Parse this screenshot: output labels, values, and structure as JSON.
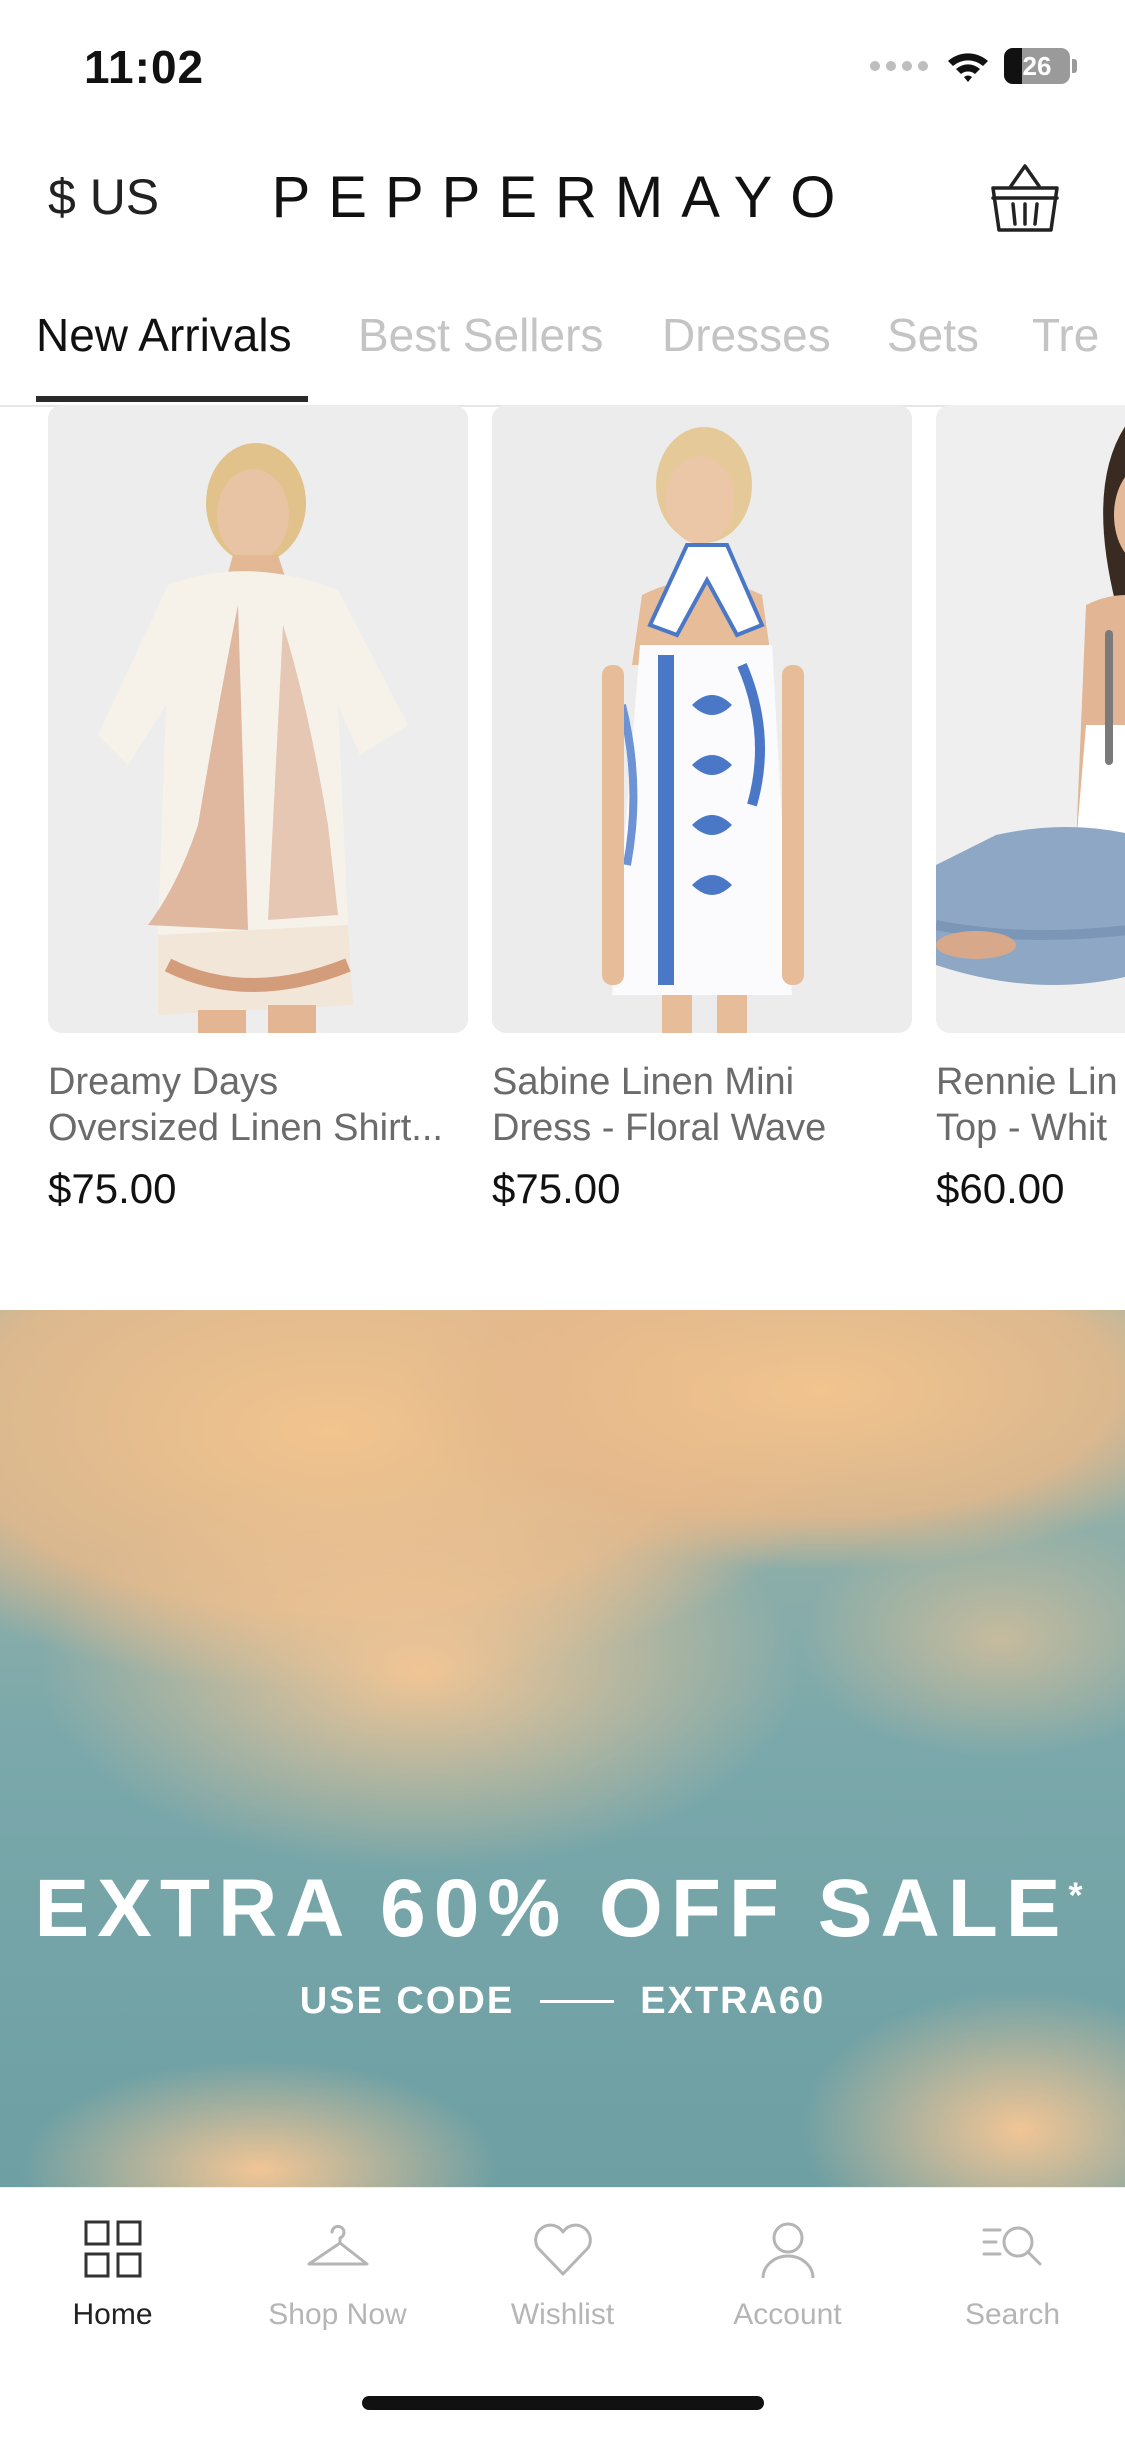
{
  "status_bar": {
    "time": "11:02",
    "battery": "26",
    "icons": [
      "cellular-icon",
      "wifi-icon",
      "battery-icon"
    ]
  },
  "header": {
    "currency": "$ US",
    "brand": "PEPPERMAYO",
    "cart_icon": "basket-icon"
  },
  "tabs": [
    {
      "label": "New Arrivals",
      "active": true
    },
    {
      "label": "Best Sellers",
      "active": false
    },
    {
      "label": "Dresses",
      "active": false
    },
    {
      "label": "Sets",
      "active": false
    },
    {
      "label": "Tre",
      "active": false
    }
  ],
  "products": [
    {
      "name": "Dreamy Days\nOversized Linen Shirt...",
      "price": "$75.00"
    },
    {
      "name": "Sabine Linen Mini\nDress - Floral Wave",
      "price": "$75.00"
    },
    {
      "name": "Rennie Lin\nTop - Whit",
      "price": "$60.00"
    }
  ],
  "banner": {
    "title": "EXTRA 60% OFF SALE",
    "asterisk": "*",
    "code_label": "USE CODE",
    "code": "EXTRA60"
  },
  "bottom_nav": [
    {
      "label": "Home",
      "icon": "grid-icon",
      "active": true
    },
    {
      "label": "Shop Now",
      "icon": "hanger-icon",
      "active": false
    },
    {
      "label": "Wishlist",
      "icon": "heart-icon",
      "active": false
    },
    {
      "label": "Account",
      "icon": "person-icon",
      "active": false
    },
    {
      "label": "Search",
      "icon": "search-icon",
      "active": false
    }
  ],
  "colors": {
    "accent": "#111111",
    "inactive": "#c4c4c4",
    "banner_sky": "#6fa1a5",
    "banner_cloud": "#e4b98a"
  }
}
